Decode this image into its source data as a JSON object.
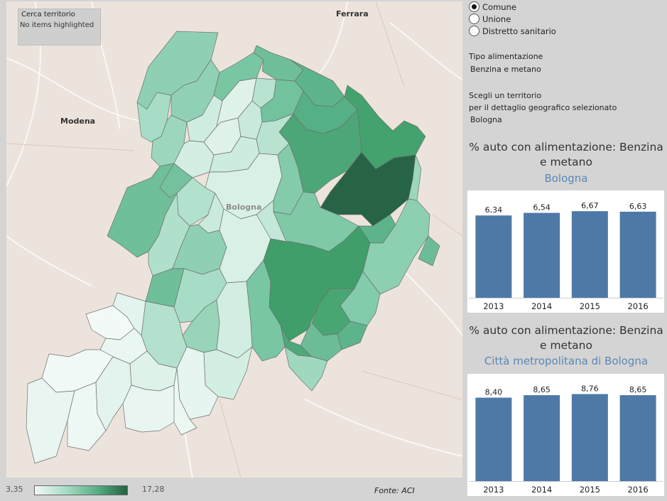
{
  "map": {
    "search_title": "Cerca territorio",
    "search_status": "No items highlighted",
    "center_label": "Bologna",
    "cities": [
      {
        "name": "Ferrara"
      },
      {
        "name": "Modena"
      }
    ],
    "legend_min": "3,35",
    "legend_max": "17,28",
    "source": "Fonte: ACI"
  },
  "radio": [
    {
      "label": "Comune",
      "selected": true
    },
    {
      "label": "Unione",
      "selected": false
    },
    {
      "label": "Distretto sanitario",
      "selected": false
    }
  ],
  "filters": {
    "fuel_title": "Tipo alimentazione",
    "fuel_value": "Benzina e metano",
    "territory_title_line1": "Scegli un territorio",
    "territory_title_line2": "per il dettaglio geografico selezionato",
    "territory_value": "Bologna"
  },
  "chart_data": [
    {
      "type": "bar",
      "title_line1": "% auto con alimentazione: Benzina",
      "title_line2": "e metano",
      "subtitle": "Bologna",
      "categories": [
        "2013",
        "2014",
        "2015",
        "2016"
      ],
      "values": [
        6.34,
        6.54,
        6.67,
        6.63
      ],
      "labels": [
        "6,34",
        "6,54",
        "6,67",
        "6,63"
      ],
      "ylim": [
        0,
        7.5
      ],
      "color": "#4e79a7"
    },
    {
      "type": "bar",
      "title_line1": "% auto con alimentazione: Benzina",
      "title_line2": "e metano",
      "subtitle": "Città metropolitana di Bologna",
      "categories": [
        "2013",
        "2014",
        "2015",
        "2016"
      ],
      "values": [
        8.4,
        8.65,
        8.76,
        8.65
      ],
      "labels": [
        "8,40",
        "8,65",
        "8,76",
        "8,65"
      ],
      "ylim": [
        0,
        9.8
      ],
      "color": "#4e79a7"
    }
  ]
}
